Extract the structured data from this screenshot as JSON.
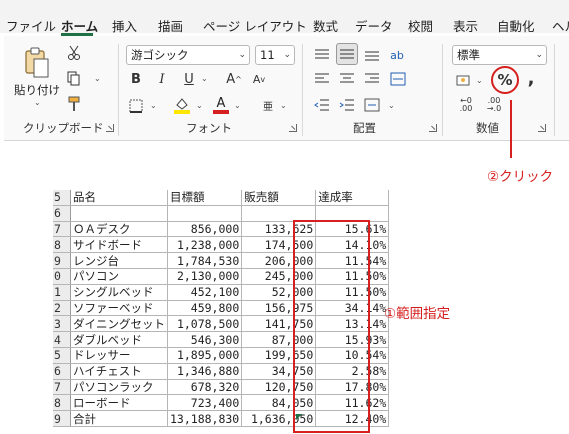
{
  "tabs": [
    "ファイル",
    "ホーム",
    "挿入",
    "描画",
    "ページ レイアウト",
    "数式",
    "データ",
    "校閲",
    "表示",
    "自動化",
    "ヘル"
  ],
  "clipboard": {
    "paste_label": "貼り付け",
    "group_label": "クリップボード"
  },
  "font": {
    "name": "游ゴシック",
    "size": "11",
    "group_label": "フォント"
  },
  "alignment": {
    "group_label": "配置"
  },
  "number": {
    "format": "標準",
    "group_label": "数値",
    "percent_symbol": "%",
    "comma_symbol": ","
  },
  "sheet": {
    "rows": [
      {
        "row": "5",
        "name": "品名",
        "c1": "目標額",
        "c2": "販売額",
        "c3": "達成率",
        "header": true
      },
      {
        "row": "6",
        "name": "",
        "c1": "",
        "c2": "",
        "c3": ""
      },
      {
        "row": "7",
        "name": "ＯＡデスク",
        "c1": "856,000",
        "c2": "133,625",
        "c3": "15.61%"
      },
      {
        "row": "8",
        "name": "サイドボード",
        "c1": "1,238,000",
        "c2": "174,500",
        "c3": "14.10%"
      },
      {
        "row": "9",
        "name": "レンジ台",
        "c1": "1,784,530",
        "c2": "206,000",
        "c3": "11.54%"
      },
      {
        "row": "0",
        "name": "パソコン",
        "c1": "2,130,000",
        "c2": "245,000",
        "c3": "11.50%"
      },
      {
        "row": "1",
        "name": "シングルベッド",
        "c1": "452,100",
        "c2": "52,000",
        "c3": "11.50%"
      },
      {
        "row": "2",
        "name": "ソファーベッド",
        "c1": "459,800",
        "c2": "156,975",
        "c3": "34.14%"
      },
      {
        "row": "3",
        "name": "ダイニングセット",
        "c1": "1,078,500",
        "c2": "141,750",
        "c3": "13.14%"
      },
      {
        "row": "4",
        "name": "ダブルベッド",
        "c1": "546,300",
        "c2": "87,000",
        "c3": "15.93%"
      },
      {
        "row": "5",
        "name": "ドレッサー",
        "c1": "1,895,000",
        "c2": "199,650",
        "c3": "10.54%"
      },
      {
        "row": "6",
        "name": "ハイチェスト",
        "c1": "1,346,880",
        "c2": "34,750",
        "c3": "2.58%"
      },
      {
        "row": "7",
        "name": "パソコンラック",
        "c1": "678,320",
        "c2": "120,750",
        "c3": "17.80%"
      },
      {
        "row": "8",
        "name": "ローボード",
        "c1": "723,400",
        "c2": "84,050",
        "c3": "11.62%"
      },
      {
        "row": "9",
        "name": "合計",
        "c1": "13,188,830",
        "c2": "1,636,050",
        "c3": "12.40%"
      }
    ]
  },
  "annotations": {
    "range": "①範囲指定",
    "click": "②クリック"
  },
  "colors": {
    "accent": "#1e7145",
    "annotation": "#d62020",
    "highlight": "#ffe600",
    "font_red": "#d62020"
  }
}
